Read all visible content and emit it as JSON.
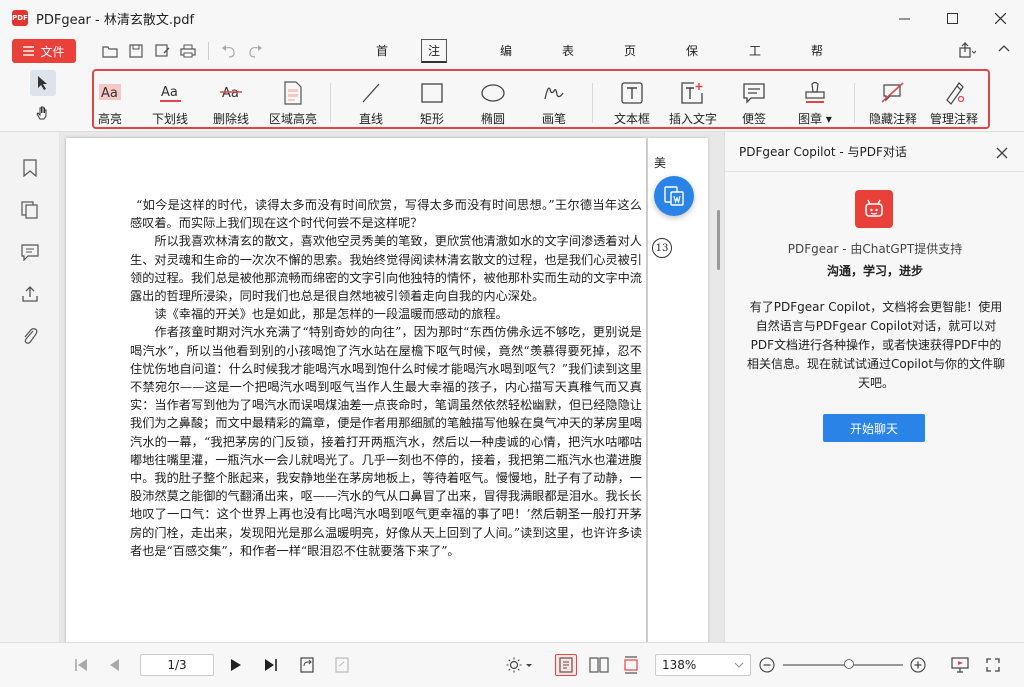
{
  "app": {
    "logo_text": "PDF",
    "title": "PDFgear - 林清玄散文.pdf"
  },
  "menu": {
    "file_label": "文件",
    "tabs": [
      "首页",
      "注释",
      "编辑",
      "表单",
      "页面",
      "保护",
      "工具",
      "帮助"
    ],
    "active_tab": "注释"
  },
  "toolbar": {
    "tools": [
      {
        "label": "高亮",
        "icon": "highlight-icon"
      },
      {
        "label": "下划线",
        "icon": "underline-icon"
      },
      {
        "label": "删除线",
        "icon": "strikethrough-icon"
      },
      {
        "label": "区域高亮",
        "icon": "area-highlight-icon"
      },
      {
        "label": "直线",
        "icon": "line-icon"
      },
      {
        "label": "矩形",
        "icon": "rectangle-icon"
      },
      {
        "label": "椭圆",
        "icon": "ellipse-icon"
      },
      {
        "label": "画笔",
        "icon": "pen-icon"
      },
      {
        "label": "文本框",
        "icon": "textbox-icon"
      },
      {
        "label": "插入文字",
        "icon": "insert-text-icon"
      },
      {
        "label": "便签",
        "icon": "sticky-note-icon"
      },
      {
        "label": "图章",
        "icon": "stamp-icon"
      },
      {
        "label": "隐藏注释",
        "icon": "hide-annotations-icon"
      },
      {
        "label": "管理注释",
        "icon": "manage-annotations-icon"
      }
    ],
    "icon_sample": "Aa",
    "stamp_caret": "▾",
    "highlight_color": "#e1454b"
  },
  "document": {
    "paragraphs": [
      "“如今是这样的时代，读得太多而没有时间欣赏，写得太多而没有时间思想。”王尔德当年这么感叹着。而实际上我们现在这个时代何尝不是这样呢？",
      "所以我喜欢林清玄的散文，喜欢他空灵秀美的笔致，更欣赏他清澈如水的文字间渗透着对人生、对灵魂和生命的一次次不懈的思索。我始终觉得阅读林清玄散文的过程，也是我们心灵被引领的过程。我们总是被他那流畅而绵密的文字引向他独特的情怀，被他那朴实而生动的文字中流露出的哲理所浸染，同时我们也总是很自然地被引领着走向自我的内心深处。",
      "读《幸福的开关》也是如此，那是怎样的一段温暖而感动的旅程。",
      "作者孩童时期对汽水充满了“特别奇妙的向往”，因为那时“东西仿佛永远不够吃，更别说是喝汽水”，所以当他看到别的小孩喝饱了汽水站在屋檐下呕气时候，竟然“羡慕得要死掉，忍不住忧伤地自问道：什么时候我才能喝汽水喝到饱什么时候才能喝汽水喝到呕气？”我们读到这里不禁宛尔——这是一个把喝汽水喝到呕气当作人生最大幸福的孩子，内心描写天真稚气而又真实：当作者写到他为了喝汽水而误喝煤油差一点丧命时，笔调虽然依然轻松幽默，但已经隐隐让我们为之鼻酸；而文中最精彩的篇章，便是作者用那细腻的笔触描写他躲在臭气冲天的茅房里喝汽水的一幕，“我把茅房的门反锁，接着打开两瓶汽水，然后以一种虔诚的心情，把汽水咕嘟咕嘟地往嘴里灌，一瓶汽水一会儿就喝光了。几乎一刻也不停的，接着，我把第二瓶汽水也灌进腹中。我的肚子整个胀起来，我安静地坐在茅房地板上，等待着呕气。慢慢地，肚子有了动静，一股沛然莫之能御的气翻涌出来，呕——汽水的气从口鼻冒了出来，冒得我满眼都是泪水。我长长地叹了一口气：这个世界上再也没有比喝汽水喝到呕气更幸福的事了吧！’然后朝圣一般打开茅房的门栓，走出来，发现阳光是那么温暖明亮，好像从天上回到了人间。”读到这里，也许许多读者也是“百感交集”，和作者一样“眼泪忍不住就要落下来了”。"
    ],
    "next_page_heading": "美",
    "next_page_number": "13"
  },
  "copilot": {
    "header": "PDFgear Copilot - 与PDF对话",
    "powered_by": "PDFgear - 由ChatGPT提供支持",
    "slogan": "沟通，学习，进步",
    "description": "有了PDFgear Copilot，文档将会更智能！使用自然语言与PDFgear Copilot对话，就可以对PDF文档进行各种操作，或者快速获得PDF中的相关信息。现在就试试通过Copilot与你的文件聊天吧。",
    "start_button": "开始聊天",
    "accent": "#2a84e8"
  },
  "status": {
    "page_display": "1/3",
    "zoom": "138%",
    "zoom_fraction": 0.55
  }
}
